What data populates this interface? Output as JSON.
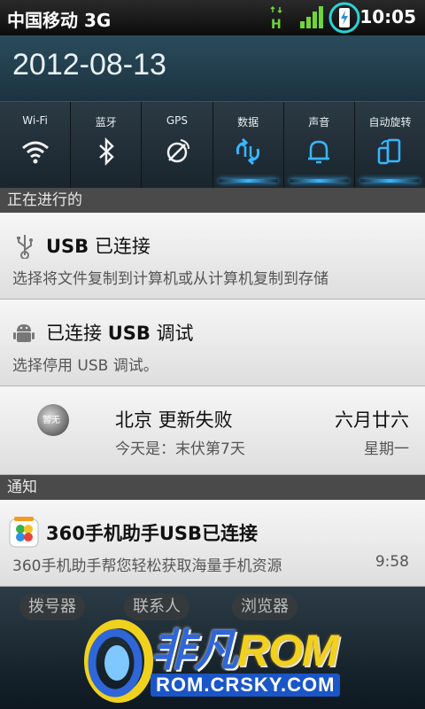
{
  "status_bar": {
    "carrier": "中国移动 3G",
    "network_indicator": "H",
    "time": "10:05",
    "icons": [
      "h-data-icon",
      "signal-icon",
      "charging-icon"
    ]
  },
  "date": "2012-08-13",
  "quick_toggles": [
    {
      "label": "Wi-Fi",
      "icon": "wifi-icon",
      "on": false
    },
    {
      "label": "蓝牙",
      "icon": "bluetooth-icon",
      "on": false
    },
    {
      "label": "GPS",
      "icon": "gps-icon",
      "on": false
    },
    {
      "label": "数据",
      "icon": "data-icon",
      "on": true
    },
    {
      "label": "声音",
      "icon": "bell-icon",
      "on": true
    },
    {
      "label": "自动旋转",
      "icon": "rotate-icon",
      "on": true
    }
  ],
  "ongoing": {
    "header": "正在进行的",
    "usb": {
      "title_bold": "USB",
      "title_rest": " 已连接",
      "subtitle": "选择将文件复制到计算机或从计算机复制到存储"
    },
    "debug": {
      "title_prefix": "已连接 ",
      "title_bold": "USB",
      "title_suffix": " 调试",
      "subtitle": "选择停用 USB 调试。"
    },
    "weather": {
      "moon_text": "暂无",
      "city_status": "北京 更新失败",
      "lunar_date": "六月廿六",
      "today": "今天是：末伏第7天",
      "weekday": "星期一"
    }
  },
  "notifications": {
    "header": "通知",
    "app": {
      "title": "360手机助手USB已连接",
      "subtitle": "360手机助手帮您轻松获取海量手机资源",
      "time": "9:58"
    }
  },
  "dock": {
    "labels": [
      "拨号器",
      "联系人",
      "浏览器"
    ]
  },
  "watermark": {
    "brand": "非凡",
    "brand2": "ROM",
    "url": "ROM.CRSKY.COM"
  },
  "colors": {
    "accent_blue": "#39b6ff",
    "signal_green": "#6fd63a"
  }
}
